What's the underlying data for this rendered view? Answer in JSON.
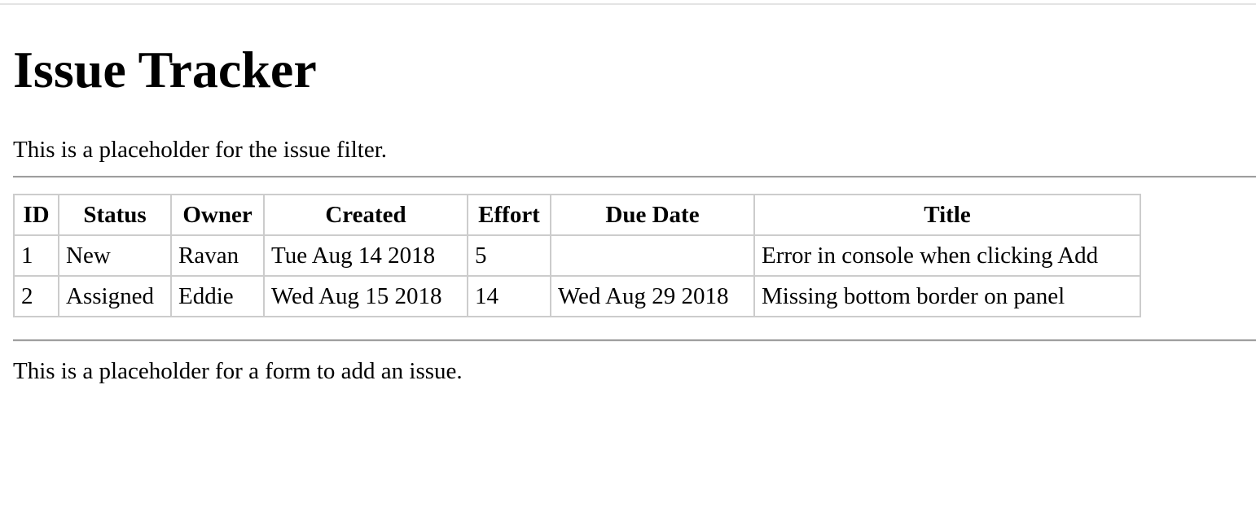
{
  "page": {
    "title": "Issue Tracker",
    "filter_placeholder": "This is a placeholder for the issue filter.",
    "add_placeholder": "This is a placeholder for a form to add an issue."
  },
  "issue_table": {
    "columns": [
      "ID",
      "Status",
      "Owner",
      "Created",
      "Effort",
      "Due Date",
      "Title"
    ],
    "rows": [
      [
        "1",
        "New",
        "Ravan",
        "Tue Aug 14 2018",
        "5",
        "",
        "Error in console when clicking Add"
      ],
      [
        "2",
        "Assigned",
        "Eddie",
        "Wed Aug 15 2018",
        "14",
        "Wed Aug 29 2018",
        "Missing bottom border on panel"
      ]
    ]
  }
}
